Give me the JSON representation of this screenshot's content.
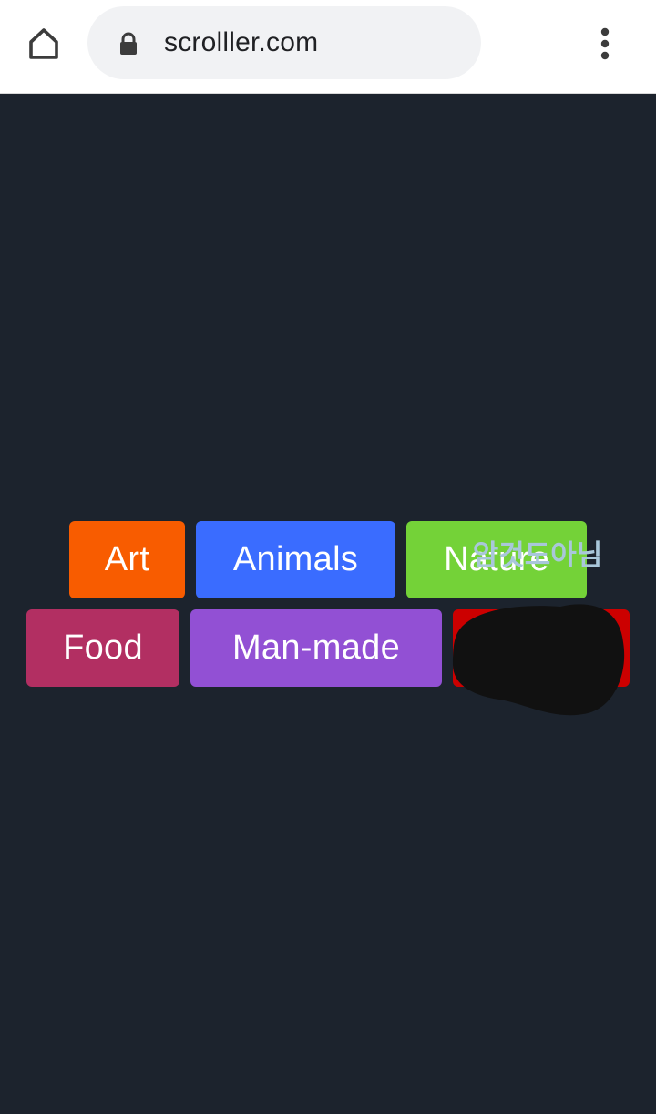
{
  "browser": {
    "url": "scrolller.com",
    "home_icon": "home-icon",
    "lock_icon": "lock-icon",
    "menu_icon": "more-vert-icon"
  },
  "categories": [
    {
      "label": "Art",
      "color": "#f85c00"
    },
    {
      "label": "Animals",
      "color": "#3a6cff"
    },
    {
      "label": "Nature",
      "color": "#74d238"
    },
    {
      "label": "Food",
      "color": "#b22f62"
    },
    {
      "label": "Man-made",
      "color": "#9250d4"
    },
    {
      "label": "",
      "color": "#cc0000"
    }
  ],
  "overlay": {
    "text": "암것도아님",
    "color": "#111111"
  }
}
